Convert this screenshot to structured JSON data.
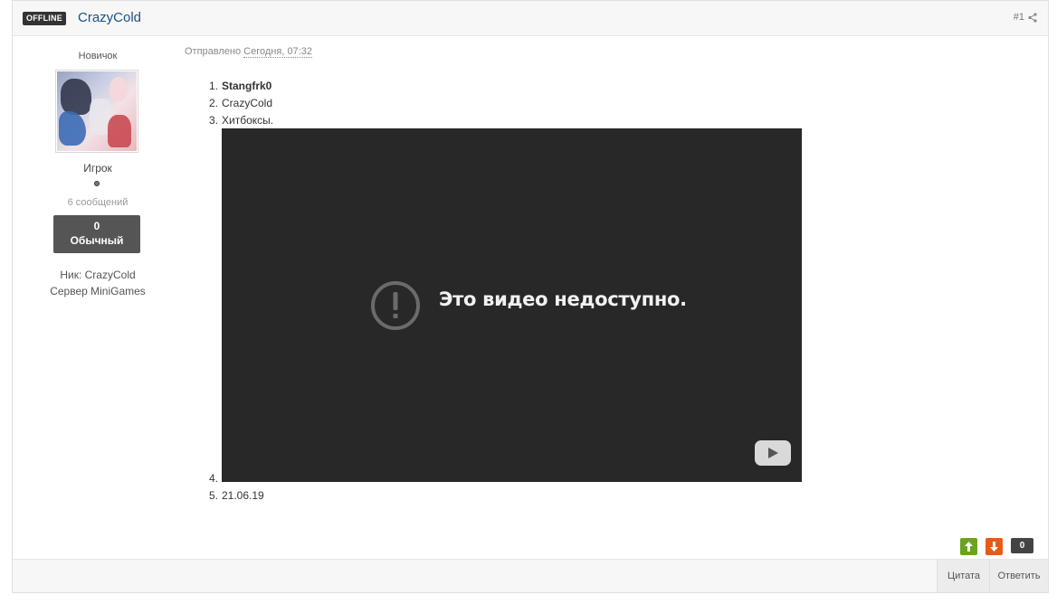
{
  "header": {
    "status_badge": "OFFLINE",
    "author": "CrazyCold",
    "post_number": "#1",
    "share_icon": "share-icon"
  },
  "author_panel": {
    "group": "Новичок",
    "rank": "Игрок",
    "posts_count": "6 сообщений",
    "reputation_value": "0",
    "reputation_label": "Обычный",
    "nick_label": "Ник: ",
    "nick_value": "CrazyCold",
    "server_label": "Сервер ",
    "server_value": "MiniGames"
  },
  "post": {
    "posted_prefix": "Отправлено ",
    "posted_date": "Сегодня, 07:32",
    "list": [
      {
        "num": "1.",
        "text": "Stangfrk0"
      },
      {
        "num": "2.",
        "text": "CrazyCold"
      },
      {
        "num": "3.",
        "text": "Хитбоксы."
      },
      {
        "num": "4.",
        "text": ""
      },
      {
        "num": "5.",
        "text": "21.06.19"
      }
    ],
    "video": {
      "message": "Это видео недоступно.",
      "background": "#282828"
    }
  },
  "votes": {
    "count": "0",
    "up_color": "#6ca31e",
    "down_color": "#e85b16"
  },
  "footer": {
    "quote_label": "Цитата",
    "reply_label": "Ответить"
  },
  "colors": {
    "author_link": "#1d5181"
  }
}
